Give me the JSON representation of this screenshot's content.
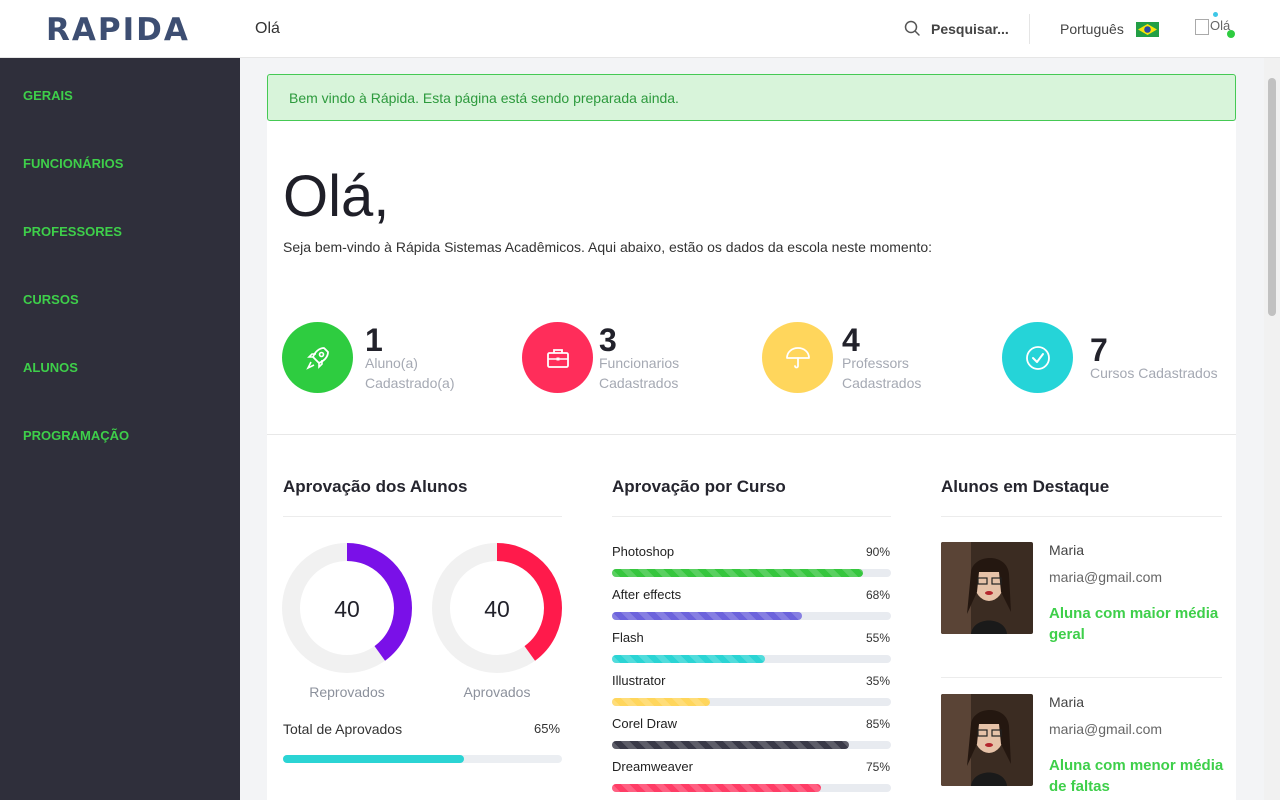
{
  "header": {
    "logo": "RAPIDA",
    "title": "Olá",
    "search_placeholder": "Pesquisar...",
    "language": "Português",
    "avatar_alt": "Olá"
  },
  "sidebar": {
    "items": [
      {
        "label": "GERAIS"
      },
      {
        "label": "FUNCIONÁRIOS"
      },
      {
        "label": "PROFESSORES"
      },
      {
        "label": "CURSOS"
      },
      {
        "label": "ALUNOS"
      },
      {
        "label": "PROGRAMAÇÃO"
      }
    ]
  },
  "alert": "Bem vindo à Rápida. Esta página está sendo preparada ainda.",
  "hero": {
    "heading": "Olá,",
    "subtitle": "Seja bem-vindo à Rápida Sistemas Acadêmicos. Aqui abaixo, estão os dados da escola neste momento:"
  },
  "stats": [
    {
      "value": "1",
      "label_line1": "Aluno(a)",
      "label_line2": "Cadastrado(a)",
      "color": "#2ecc40",
      "icon": "rocket-icon"
    },
    {
      "value": "3",
      "label_line1": "Funcionarios",
      "label_line2": "Cadastrados",
      "color": "#ff2d5a",
      "icon": "briefcase-icon"
    },
    {
      "value": "4",
      "label_line1": "Professors",
      "label_line2": "Cadastrados",
      "color": "#ffd65c",
      "icon": "umbrella-icon"
    },
    {
      "value": "7",
      "label_line1": "Cursos Cadastrados",
      "label_line2": "",
      "color": "#25d4d8",
      "icon": "check-circle-icon"
    }
  ],
  "approval": {
    "title": "Aprovação dos Alunos",
    "donuts": [
      {
        "value": "40",
        "label": "Reprovados",
        "percent": 40,
        "color": "#7a10e8"
      },
      {
        "value": "40",
        "label": "Aprovados",
        "percent": 40,
        "color": "#ff1a4b"
      }
    ],
    "total_label": "Total de Aprovados",
    "total_percent_text": "65%",
    "total_percent": 65,
    "total_color": "#2bd4d4"
  },
  "courses": {
    "title": "Aprovação por Curso",
    "items": [
      {
        "label": "Photoshop",
        "percent_text": "90%",
        "percent": 90,
        "color": "#36c63e"
      },
      {
        "label": "After effects",
        "percent_text": "68%",
        "percent": 68,
        "color": "#6c63dc"
      },
      {
        "label": "Flash",
        "percent_text": "55%",
        "percent": 55,
        "color": "#2bd4d4"
      },
      {
        "label": "Illustrator",
        "percent_text": "35%",
        "percent": 35,
        "color": "#ffd65c"
      },
      {
        "label": "Corel Draw",
        "percent_text": "85%",
        "percent": 85,
        "color": "#3a3a48"
      },
      {
        "label": "Dreamweaver",
        "percent_text": "75%",
        "percent": 75,
        "color": "#ff3d66"
      }
    ]
  },
  "featured": {
    "title": "Alunos em Destaque",
    "students": [
      {
        "name": "Maria",
        "email": "maria@gmail.com",
        "note": "Aluna com maior média geral"
      },
      {
        "name": "Maria",
        "email": "maria@gmail.com",
        "note": "Aluna com menor média de faltas"
      }
    ]
  }
}
